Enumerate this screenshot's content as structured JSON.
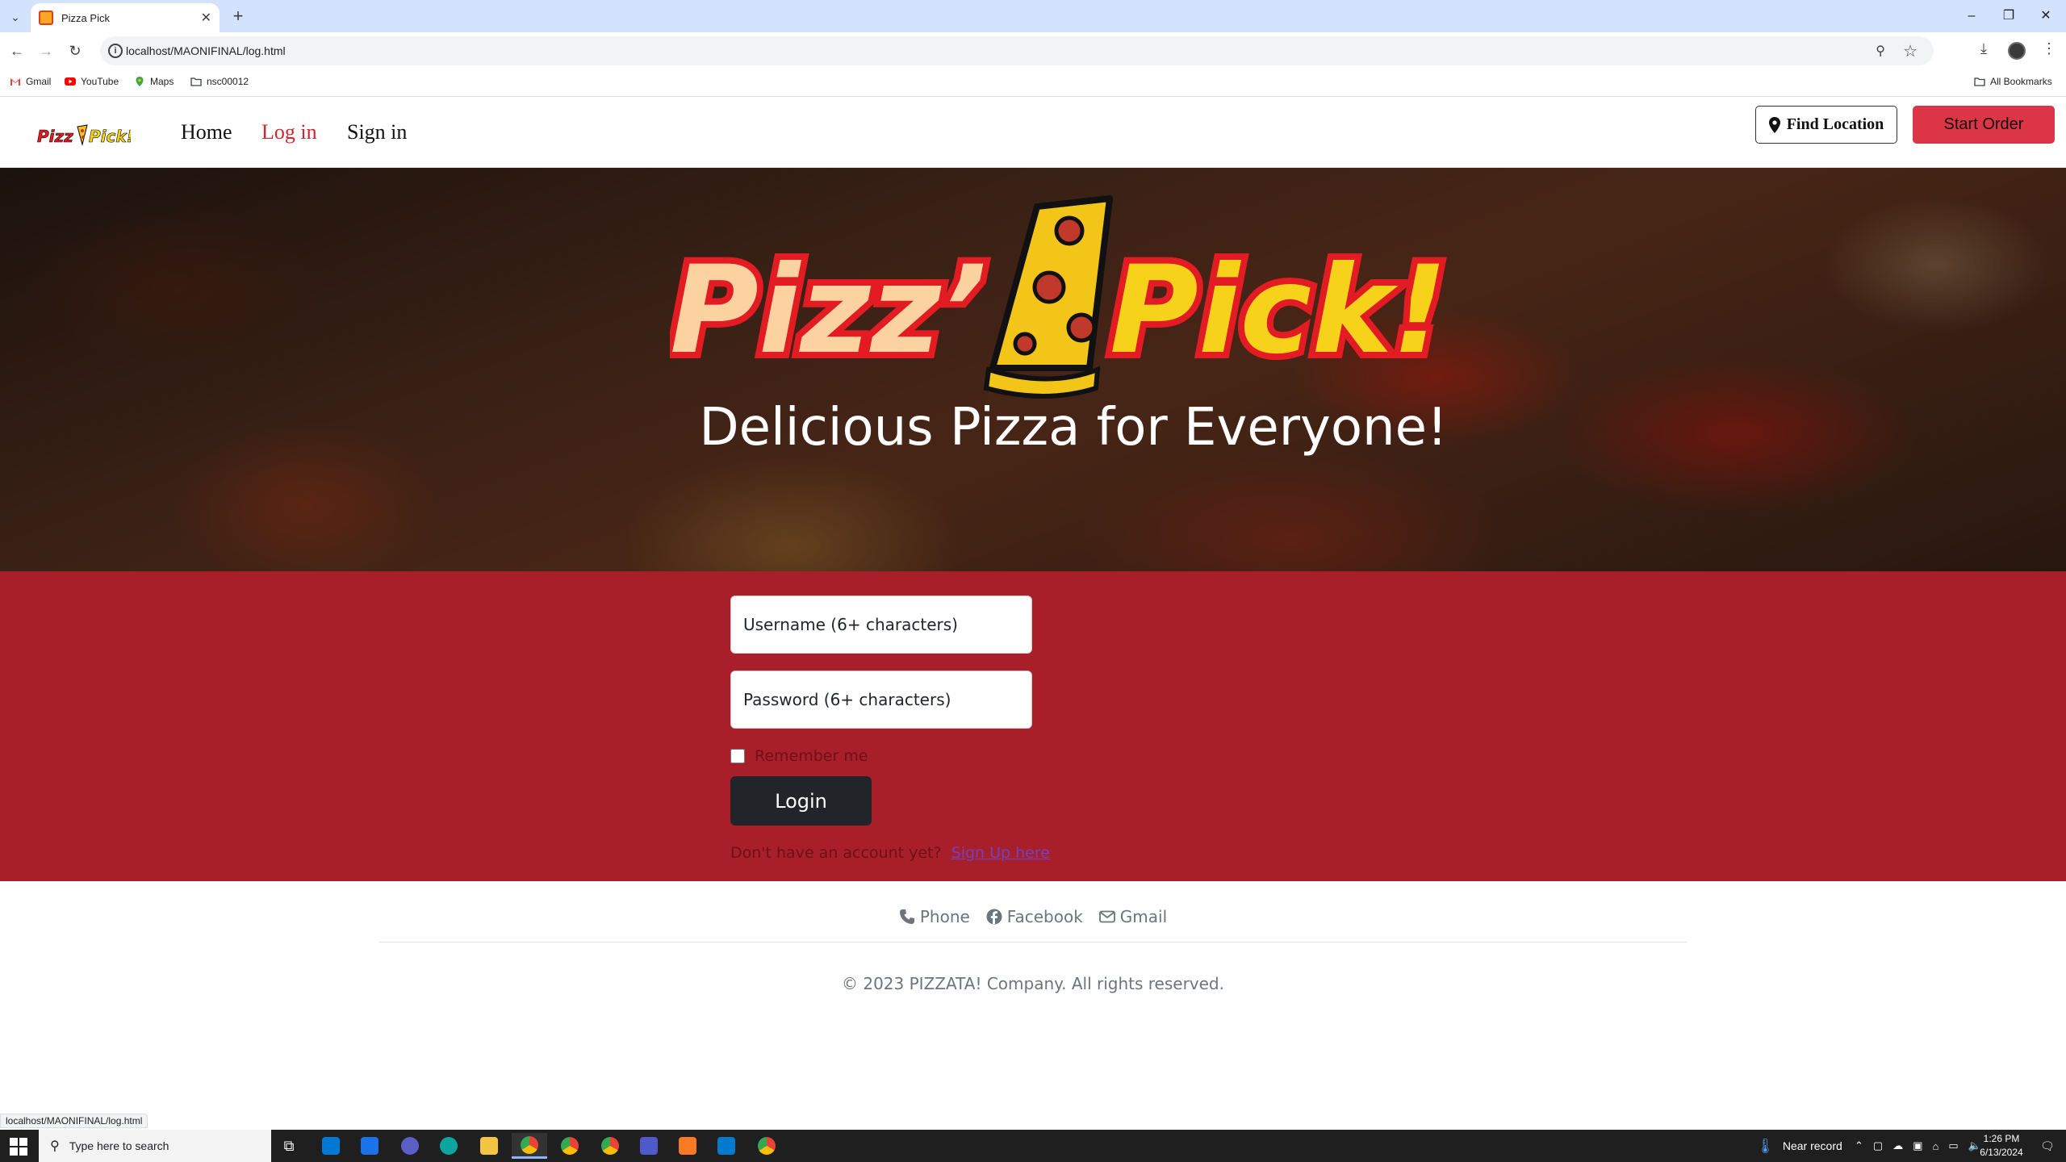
{
  "browser": {
    "tab_title": "Pizza Pick",
    "url": "localhost/MAONIFINAL/log.html",
    "bookmarks": [
      "Gmail",
      "YouTube",
      "Maps",
      "nsc00012"
    ],
    "all_bookmarks": "All Bookmarks",
    "status_url": "localhost/MAONIFINAL/log.html"
  },
  "nav": {
    "links": [
      "Home",
      "Log in",
      "Sign in"
    ],
    "find_location": "Find Location",
    "start_order": "Start Order"
  },
  "hero": {
    "logo_text_left": "Pizz’",
    "logo_text_right": "Pick!",
    "tagline": "Delicious Pizza for Everyone!"
  },
  "login": {
    "username_placeholder": "Username (6+ characters)",
    "password_placeholder": "Password (6+ characters)",
    "remember_label": "Remember me",
    "login_button": "Login",
    "signup_prompt": "Don't have an account yet?",
    "signup_link": "Sign Up here"
  },
  "footer": {
    "links": [
      "Phone",
      "Facebook",
      "Gmail"
    ],
    "copyright": "© 2023 PIZZATA! Company.  All rights reserved."
  },
  "taskbar": {
    "search_placeholder": "Type here to search",
    "weather": "Near record",
    "time": "1:26 PM",
    "date": "6/13/2024"
  },
  "colors": {
    "brand_red": "#dc3545",
    "login_bg": "#a91f29",
    "active_nav": "#d4242b"
  }
}
